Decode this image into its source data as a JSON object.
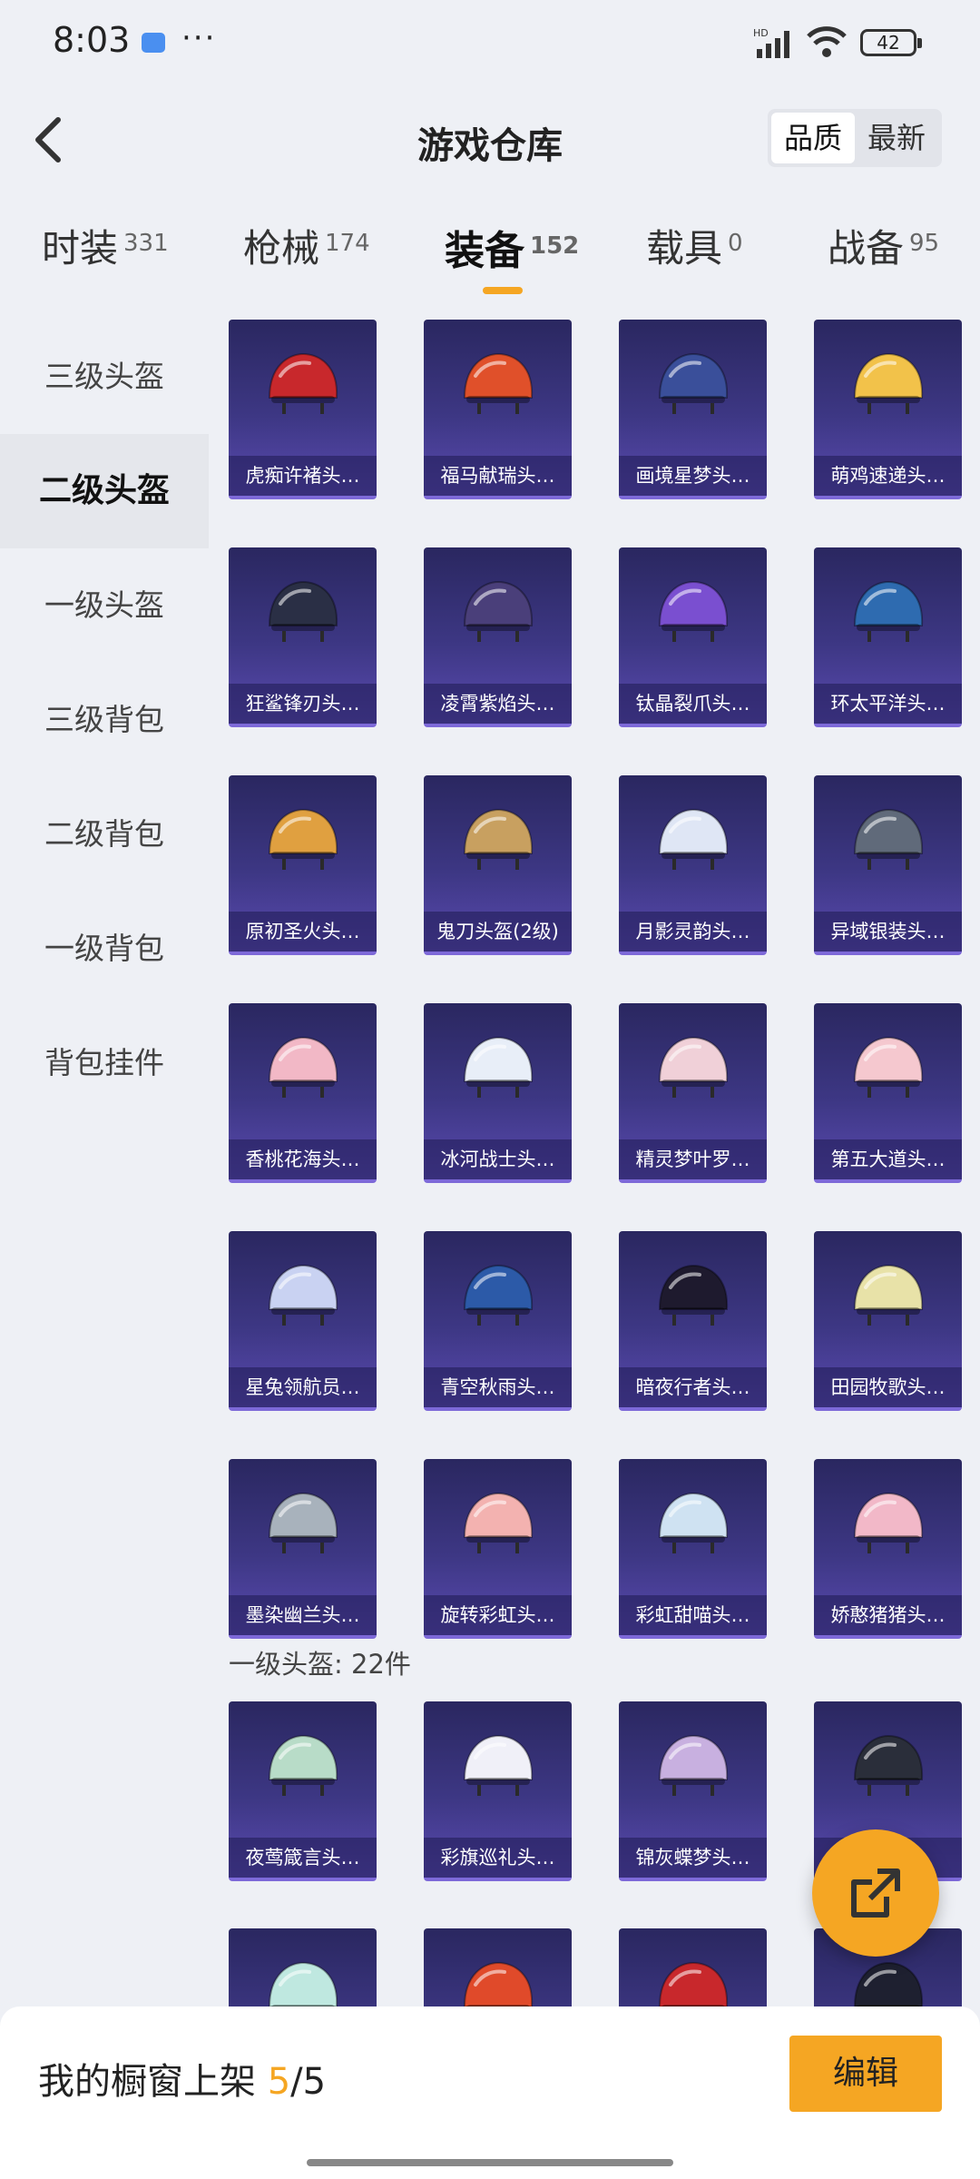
{
  "status": {
    "time": "8:03",
    "more": "···",
    "battery": "42",
    "signal_label": "HD"
  },
  "header": {
    "title": "游戏仓库",
    "sort_options": [
      "品质",
      "最新"
    ],
    "sort_selected": "品质"
  },
  "tabs": [
    {
      "label": "时装",
      "count": "331"
    },
    {
      "label": "枪械",
      "count": "174"
    },
    {
      "label": "装备",
      "count": "152"
    },
    {
      "label": "载具",
      "count": "0"
    },
    {
      "label": "战备",
      "count": "95"
    }
  ],
  "side": [
    "三级头盔",
    "二级头盔",
    "一级头盔",
    "三级背包",
    "二级背包",
    "一级背包",
    "背包挂件"
  ],
  "items": [
    {
      "name": "虎痴许褚头…",
      "color": "#c8282c"
    },
    {
      "name": "福马献瑞头…",
      "color": "#e0502a"
    },
    {
      "name": "画境星梦头…",
      "color": "#3a4f9a"
    },
    {
      "name": "萌鸡速递头…",
      "color": "#f2c24a"
    },
    {
      "name": "狂鲨锋刃头…",
      "color": "#2a2f45"
    },
    {
      "name": "凌霄紫焰头…",
      "color": "#4a3f7a"
    },
    {
      "name": "钛晶裂爪头…",
      "color": "#7a4fd0"
    },
    {
      "name": "环太平洋头…",
      "color": "#2e6bb0"
    },
    {
      "name": "原初圣火头…",
      "color": "#e0a040"
    },
    {
      "name": "鬼刀头盔(2级)",
      "color": "#c8a060"
    },
    {
      "name": "月影灵韵头…",
      "color": "#dfe6f5"
    },
    {
      "name": "异域银装头…",
      "color": "#606a7a"
    },
    {
      "name": "香桃花海头…",
      "color": "#f2b8c6"
    },
    {
      "name": "冰河战士头…",
      "color": "#e8eef8"
    },
    {
      "name": "精灵梦叶罗…",
      "color": "#f0d0d8"
    },
    {
      "name": "第五大道头…",
      "color": "#f5c8cf"
    },
    {
      "name": "星兔领航员…",
      "color": "#c9d2f2"
    },
    {
      "name": "青空秋雨头…",
      "color": "#2c5aa8"
    },
    {
      "name": "暗夜行者头…",
      "color": "#1e1a2e"
    },
    {
      "name": "田园牧歌头…",
      "color": "#e8e2a8"
    },
    {
      "name": "墨染幽兰头…",
      "color": "#a8b2bc"
    },
    {
      "name": "旋转彩虹头…",
      "color": "#f3b2b0"
    },
    {
      "name": "彩虹甜喵头…",
      "color": "#cfe2f2"
    },
    {
      "name": "娇憨猪猪头…",
      "color": "#f2b8c8"
    }
  ],
  "section": {
    "title": "一级头盔: 22件"
  },
  "items2": [
    {
      "name": "夜莺箴言头…",
      "color": "#b8dcc8"
    },
    {
      "name": "彩旗巡礼头…",
      "color": "#f0f0f8"
    },
    {
      "name": "锦灰蝶梦头…",
      "color": "#c8b0e0"
    },
    {
      "name": "",
      "color": "#2a2e3a"
    }
  ],
  "items3": [
    {
      "color": "#bfe8e0"
    },
    {
      "color": "#e04a2a"
    },
    {
      "color": "#c8282c"
    },
    {
      "color": "#1e2030"
    }
  ],
  "bottom": {
    "label": "我的橱窗上架",
    "current": "5",
    "total": "/5",
    "edit": "编辑"
  }
}
